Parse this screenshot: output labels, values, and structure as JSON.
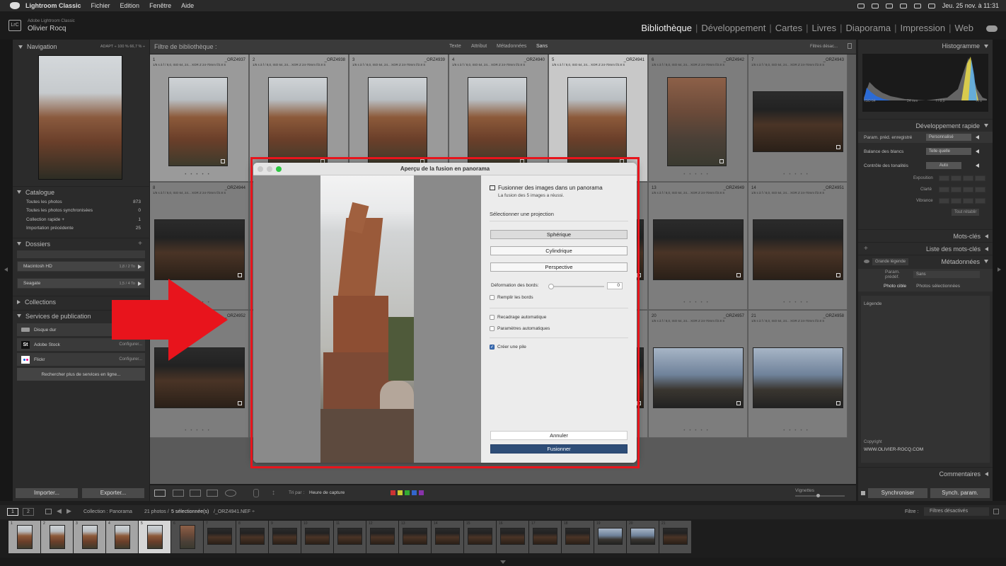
{
  "menubar": {
    "app": "Lightroom Classic",
    "items": [
      "Fichier",
      "Edition",
      "Fenêtre",
      "Aide"
    ],
    "datetime": "Jeu. 25 nov. à  11:31"
  },
  "identity": {
    "logo": "LrC",
    "app": "Adobe Lightroom Classic",
    "user": "Olivier Rocq"
  },
  "modules": [
    "Bibliothèque",
    "Développement",
    "Cartes",
    "Livres",
    "Diaporama",
    "Impression",
    "Web"
  ],
  "navigator": {
    "title": "Navigation",
    "opts": "ADAPT ÷   100 %   66,7 % ÷"
  },
  "catalogue": {
    "title": "Catalogue",
    "rows": [
      {
        "label": "Toutes les photos",
        "count": "873"
      },
      {
        "label": "Toutes les photos synchronisées",
        "count": "0"
      },
      {
        "label": "Collection rapide +",
        "count": "1"
      },
      {
        "label": "Importation précédente",
        "count": "25"
      }
    ]
  },
  "dossiers": {
    "title": "Dossiers",
    "plus": "+",
    "drives": [
      {
        "label": "Macintosh HD",
        "value": "1,8 / 2 To"
      },
      {
        "label": "Seagate",
        "value": "1,5 / 4 To"
      }
    ]
  },
  "collections": {
    "title": "Collections"
  },
  "services": {
    "title": "Services de publication",
    "plus": "+",
    "items": [
      {
        "icon": "hard-drive-icon",
        "label": "Disque dur",
        "action": ""
      },
      {
        "icon": "adobe-stock-icon",
        "icon_text": "St",
        "label": "Adobe Stock",
        "action": "Configurer..."
      },
      {
        "icon": "flickr-icon",
        "label": "Flickr",
        "action": "Configurer..."
      }
    ],
    "more": "Rechercher plus de services en ligne..."
  },
  "filterbar": {
    "label": "Filtre de bibliothèque :",
    "tabs": [
      "Texte",
      "Attribut",
      "Métadonnées",
      "Sans"
    ],
    "right": "Filtres désac..."
  },
  "grid": {
    "meta": "1/6 s à f / 8,0, ISO 64, 24... XOR Z 24-70mm f/2.8 S",
    "cells": [
      {
        "num": "1",
        "name": "_ORZ4937",
        "type": "rock",
        "sel": "1"
      },
      {
        "num": "2",
        "name": "_ORZ4938",
        "type": "rock",
        "sel": "1"
      },
      {
        "num": "3",
        "name": "_ORZ4939",
        "type": "rock",
        "sel": "1"
      },
      {
        "num": "4",
        "name": "_ORZ4940",
        "type": "rock",
        "sel": "1"
      },
      {
        "num": "5",
        "name": "_ORZ4941",
        "type": "rock",
        "sel": "2"
      },
      {
        "num": "6",
        "name": "_ORZ4942",
        "type": "fist",
        "sel": "0"
      },
      {
        "num": "7",
        "name": "_ORZ4943",
        "type": "dark",
        "sel": "0"
      },
      {
        "num": "8",
        "name": "_ORZ4944",
        "type": "dark",
        "sel": "0"
      },
      {
        "num": "",
        "name": "",
        "type": "dark",
        "sel": "0"
      },
      {
        "num": "",
        "name": "",
        "type": "dark",
        "sel": "0"
      },
      {
        "num": "",
        "name": "",
        "type": "dark",
        "sel": "0"
      },
      {
        "num": "",
        "name": "",
        "type": "dark",
        "sel": "0"
      },
      {
        "num": "13",
        "name": "_ORZ4949",
        "type": "dark",
        "sel": "0"
      },
      {
        "num": "14",
        "name": "_ORZ4951",
        "type": "dark",
        "sel": "0"
      },
      {
        "num": "",
        "name": "_ORZ4952",
        "type": "dark",
        "sel": "0"
      },
      {
        "num": "",
        "name": "",
        "type": "dark",
        "sel": "0"
      },
      {
        "num": "",
        "name": "",
        "type": "dark",
        "sel": "0"
      },
      {
        "num": "",
        "name": "",
        "type": "dark",
        "sel": "0"
      },
      {
        "num": "",
        "name": "",
        "type": "dark",
        "sel": "0"
      },
      {
        "num": "20",
        "name": "_ORZ4957",
        "type": "sky",
        "sel": "0"
      },
      {
        "num": "21",
        "name": "_ORZ4958",
        "type": "sky",
        "sel": "0"
      }
    ]
  },
  "histogram": {
    "title": "Histogramme",
    "iso": "ISO 64",
    "focal": "24 mm",
    "aperture": "f / 8,0",
    "shutter": "⅙ s"
  },
  "quickdev": {
    "title": "Développement rapide",
    "preset_label": "Param. préd. enregistré",
    "preset": "Personnalisé",
    "wb_label": "Balance des blancs",
    "wb": "Telle quelle",
    "tone_label": "Contrôle des tonalités",
    "tone": "Auto",
    "exposure": "Exposition",
    "clarity": "Clarté",
    "vibrance": "Vibrance",
    "reset": "Tout rétablir"
  },
  "keywords": {
    "title": "Mots-clés"
  },
  "keywordlist": {
    "title": "Liste des mots-clés",
    "plus": "+"
  },
  "metadata": {
    "title": "Métadonnées",
    "mode": "Grande légende",
    "preset_label": "Param. prédéf.",
    "preset": "Sans",
    "tab1": "Photo cible",
    "tab2": "Photos sélectionnées",
    "caption": "Légende",
    "copyright_label": "Copyright",
    "copyright": "WWW.OLIVIER-ROCQ.COM"
  },
  "comments": {
    "title": "Commentaires"
  },
  "dialog": {
    "title": "Aperçu de la fusion en panorama",
    "heading": "Fusionner des images dans un panorama",
    "status": "La fusion des 5 images a réussi.",
    "proj_label": "Sélectionner une projection",
    "projections": [
      "Sphérique",
      "Cylindrique",
      "Perspective"
    ],
    "warp_label": "Déformation des bords:",
    "warp_value": "0",
    "fill": "Remplir les bords",
    "autocrop": "Recadrage automatique",
    "autosettings": "Paramètres automatiques",
    "stack": "Créer une pile",
    "cancel": "Annuler",
    "merge": "Fusionner"
  },
  "toolbar": {
    "sort_label": "Tri par :",
    "sort": "Heure de capture",
    "vignettes": "Vignettes",
    "colors": [
      "#cc3333",
      "#cccc33",
      "#33aa33",
      "#3366cc",
      "#8833aa"
    ]
  },
  "buttons": {
    "import": "Importer...",
    "export": "Exporter...",
    "sync": "Synchroniser",
    "syncparams": "Synch. param."
  },
  "filmbar": {
    "pages": [
      "1",
      "2"
    ],
    "collection": "Collection : Panorama",
    "count": "21 photos /",
    "selected": "5 sélectionnée(s)",
    "file": "/_ORZ4941.NEF ÷",
    "filter_label": "Filtre :",
    "filter": "Filtres désactivés"
  },
  "filmstrip": [
    {
      "n": "1",
      "t": "rock",
      "s": "1"
    },
    {
      "n": "2",
      "t": "rock",
      "s": "1"
    },
    {
      "n": "3",
      "t": "rock",
      "s": "1"
    },
    {
      "n": "4",
      "t": "rock",
      "s": "1"
    },
    {
      "n": "5",
      "t": "rock",
      "s": "2"
    },
    {
      "n": "6",
      "t": "fist",
      "s": "0"
    },
    {
      "n": "7",
      "t": "dark",
      "s": "0"
    },
    {
      "n": "8",
      "t": "dark",
      "s": "0"
    },
    {
      "n": "9",
      "t": "dark",
      "s": "0"
    },
    {
      "n": "10",
      "t": "dark",
      "s": "0"
    },
    {
      "n": "11",
      "t": "dark",
      "s": "0"
    },
    {
      "n": "12",
      "t": "dark",
      "s": "0"
    },
    {
      "n": "13",
      "t": "dark",
      "s": "0"
    },
    {
      "n": "14",
      "t": "dark",
      "s": "0"
    },
    {
      "n": "15",
      "t": "dark",
      "s": "0"
    },
    {
      "n": "16",
      "t": "dark",
      "s": "0"
    },
    {
      "n": "17",
      "t": "dark",
      "s": "0"
    },
    {
      "n": "18",
      "t": "dark",
      "s": "0"
    },
    {
      "n": "19",
      "t": "sky",
      "s": "0"
    },
    {
      "n": "20",
      "t": "sky",
      "s": "0"
    },
    {
      "n": "21",
      "t": "dark",
      "s": "0"
    }
  ],
  "annotation": {
    "box_color": "#e8141c",
    "arrow_color": "#e8141c"
  }
}
